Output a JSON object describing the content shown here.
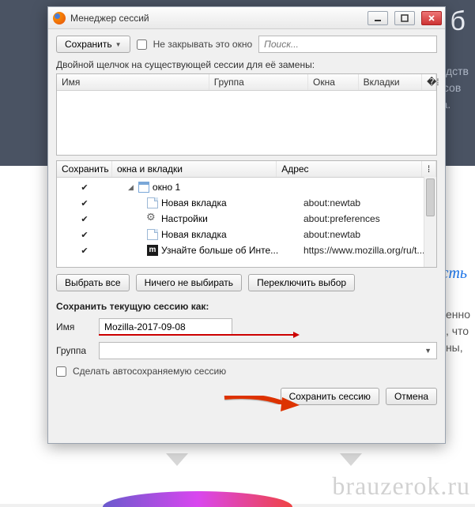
{
  "window": {
    "title": "Менеджер сессий"
  },
  "toolbar": {
    "save_dropdown": "Сохранить",
    "dont_close_label": "Не закрывать это окно",
    "search_placeholder": "Поиск..."
  },
  "sessions": {
    "hint": "Двойной щелчок на существующей сессии для её замены:",
    "headers": {
      "name": "Имя",
      "group": "Группа",
      "windows": "Окна",
      "tabs": "Вкладки"
    }
  },
  "tree": {
    "headers": {
      "save": "Сохранить",
      "wt": "окна и вкладки",
      "addr": "Адрес"
    },
    "rows": [
      {
        "checked": true,
        "indent": 1,
        "expand": true,
        "icon": "win",
        "label": "окно 1",
        "addr": ""
      },
      {
        "checked": true,
        "indent": 2,
        "icon": "page",
        "label": "Новая вкладка",
        "addr": "about:newtab"
      },
      {
        "checked": true,
        "indent": 2,
        "icon": "gear",
        "label": "Настройки",
        "addr": "about:preferences"
      },
      {
        "checked": true,
        "indent": 2,
        "icon": "page",
        "label": "Новая вкладка",
        "addr": "about:newtab"
      },
      {
        "checked": true,
        "indent": 2,
        "icon": "moz",
        "label": "Узнайте больше об Инте...",
        "addr": "https://www.mozilla.org/ru/t..."
      }
    ]
  },
  "selbtns": {
    "all": "Выбрать все",
    "none": "Ничего не выбирать",
    "toggle": "Переключить выбор"
  },
  "save": {
    "section": "Сохранить текущую сессию как:",
    "name_label": "Имя",
    "name_value": "Mozilla-2017-09-08",
    "group_label": "Группа",
    "autosave_label": "Сделать автосохраняемую сессию",
    "save_btn": "Сохранить сессию",
    "cancel_btn": "Отмена"
  },
  "bg": {
    "big": "б",
    "l1": "водств",
    "l2": "е сов",
    "l3": "illa.",
    "link": "сть",
    "p1": "енно",
    "p2": ", что",
    "p3": "ны,",
    "watermark": "brauzerok.ru"
  }
}
